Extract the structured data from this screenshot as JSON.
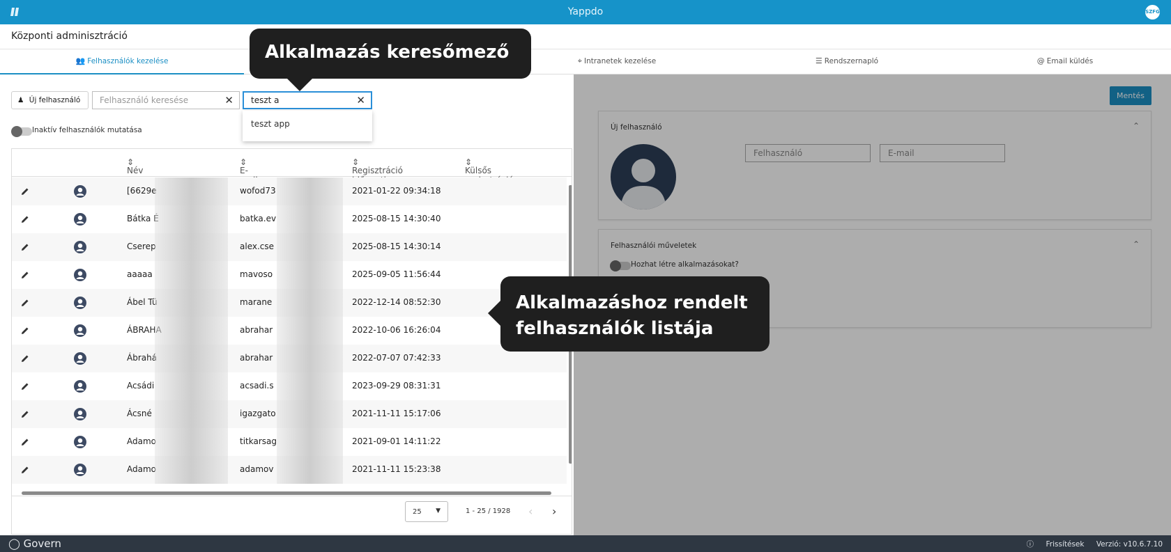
{
  "app": {
    "title": "Yappdo",
    "avatar_initials": "SZFG"
  },
  "page": {
    "title": "Központi adminisztráció"
  },
  "tabs": [
    {
      "label": "Felhasználók kezelése",
      "icon": "users-icon",
      "active": true
    },
    {
      "label": "Intranetek kezelése",
      "icon": "network-icon"
    },
    {
      "label": "Rendszernapló",
      "icon": "list-icon"
    },
    {
      "label": "Email küldés",
      "icon": "at-icon"
    }
  ],
  "toolbar": {
    "new_user_label": "Új felhasználó",
    "user_search_placeholder": "Felhasználó keresése",
    "app_search_value": "teszt a",
    "suggestion": "teszt app",
    "inactive_toggle_label": "Inaktív felhasználók mutatása"
  },
  "table": {
    "columns": [
      "Név",
      "E-mail",
      "Regisztráció időpontja",
      "Külsős regisztráció"
    ],
    "rows": [
      {
        "name": "[6629e",
        "email": "wofod73",
        "registered": "2021-01-22 09:34:18"
      },
      {
        "name": "Bátka É",
        "email": "batka.ev",
        "registered": "2025-08-15 14:30:40"
      },
      {
        "name": "Cserep",
        "email": "alex.cse",
        "registered": "2025-08-15 14:30:14"
      },
      {
        "name": "aaaaa",
        "email": "mavoso",
        "registered": "2025-09-05 11:56:44"
      },
      {
        "name": "Ábel Tü",
        "email": "marane",
        "registered": "2022-12-14 08:52:30"
      },
      {
        "name": "ÁBRAHA",
        "email": "abrahar",
        "registered": "2022-10-06 16:26:04"
      },
      {
        "name": "Ábrahá",
        "email": "abrahar",
        "registered": "2022-07-07 07:42:33"
      },
      {
        "name": "Acsádi",
        "email": "acsadi.s",
        "registered": "2023-09-29 08:31:31"
      },
      {
        "name": "Ácsné",
        "email": "igazgato",
        "registered": "2021-11-11 15:17:06"
      },
      {
        "name": "Adamo",
        "email": "titkarsag",
        "registered": "2021-09-01 14:11:22"
      },
      {
        "name": "Adamo",
        "email": "adamov",
        "registered": "2021-11-11 15:23:38"
      }
    ]
  },
  "pager": {
    "page_size": "25",
    "range": "1 - 25 / 1928"
  },
  "right": {
    "save_label": "Mentés",
    "new_user_card_title": "Új felhasználó",
    "username_placeholder": "Felhasználó",
    "email_placeholder": "E-mail",
    "ops_card_title": "Felhasználói műveletek",
    "can_create_apps_label": "Hozhat létre alkalmazásokat?"
  },
  "footer": {
    "brand": "Govern",
    "updates_label": "Frissítések",
    "version": "Verzió: v10.6.7.10"
  },
  "callouts": {
    "search_field": "Alkalmazás keresőmező",
    "user_list_line1": "Alkalmazáshoz rendelt",
    "user_list_line2": "felhasználók listája"
  }
}
